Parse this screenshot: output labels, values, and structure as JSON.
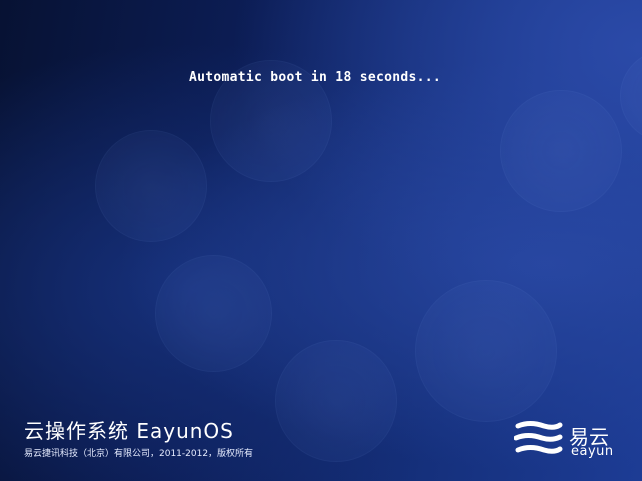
{
  "boot": {
    "message": "Automatic boot in 18 seconds..."
  },
  "branding": {
    "product_title": "云操作系统 EayunOS",
    "copyright": "易云捷讯科技（北京）有限公司，2011-2012，版权所有",
    "logo_cn": "易云",
    "logo_en": "eayun",
    "logo_icon": "eayun-logo-icon"
  },
  "colors": {
    "background": "#0b1a4c",
    "text": "#ffffff"
  }
}
